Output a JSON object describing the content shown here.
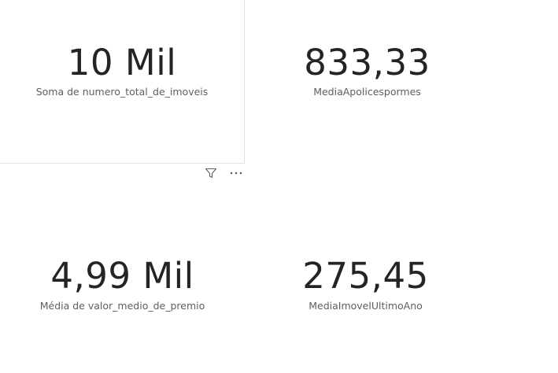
{
  "cards": [
    {
      "value": "10 Mil",
      "label": "Soma de numero_total_de_imoveis"
    },
    {
      "value": "833,33",
      "label": "MediaApolicespormes"
    },
    {
      "value": "4,99 Mil",
      "label": "Média de valor_medio_de_premio"
    },
    {
      "value": "275,45",
      "label": "MediaImovelUltimoAno"
    }
  ],
  "visual_header": {
    "icons": [
      "filter-icon",
      "more-options-icon"
    ]
  },
  "colors": {
    "value_text": "#252423",
    "label_text": "#605e5c",
    "selection_border": "#e3e3e3",
    "icon": "#605e5c"
  }
}
